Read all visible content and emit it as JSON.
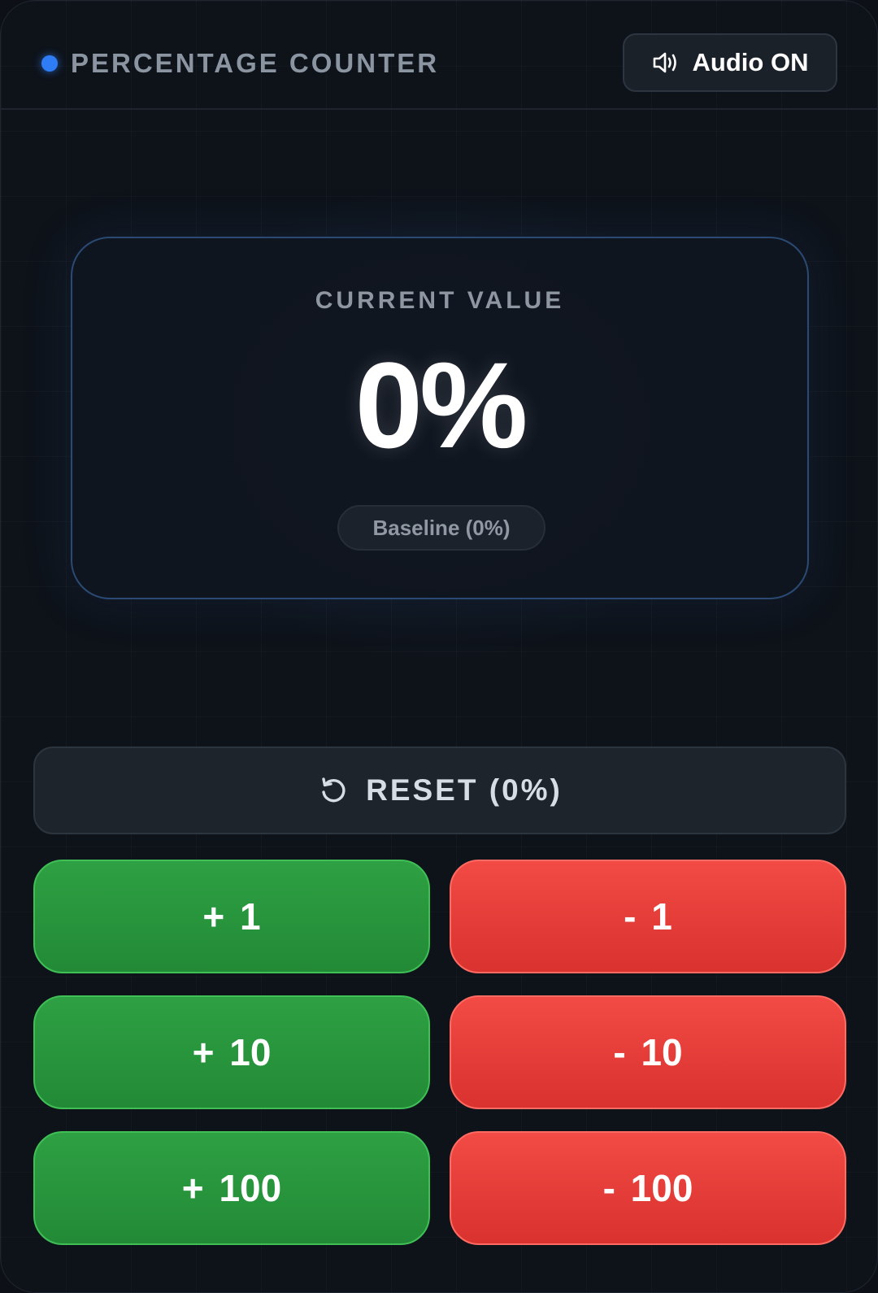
{
  "header": {
    "title": "PERCENTAGE COUNTER",
    "audio_label": "Audio ON"
  },
  "display": {
    "label": "CURRENT VALUE",
    "value": "0%",
    "badge": "Baseline (0%)"
  },
  "controls": {
    "reset_label": "RESET (0%)",
    "plus_1": "+ 1",
    "minus_1": "- 1",
    "plus_10": "+ 10",
    "minus_10": "- 10",
    "plus_100": "+ 100",
    "minus_100": "- 100"
  },
  "colors": {
    "accent": "#2f7df6",
    "increment": "#2ea043",
    "decrement": "#f24a44"
  },
  "icons": {
    "audio": "speaker-icon",
    "reset": "reset-icon",
    "status": "status-dot"
  }
}
